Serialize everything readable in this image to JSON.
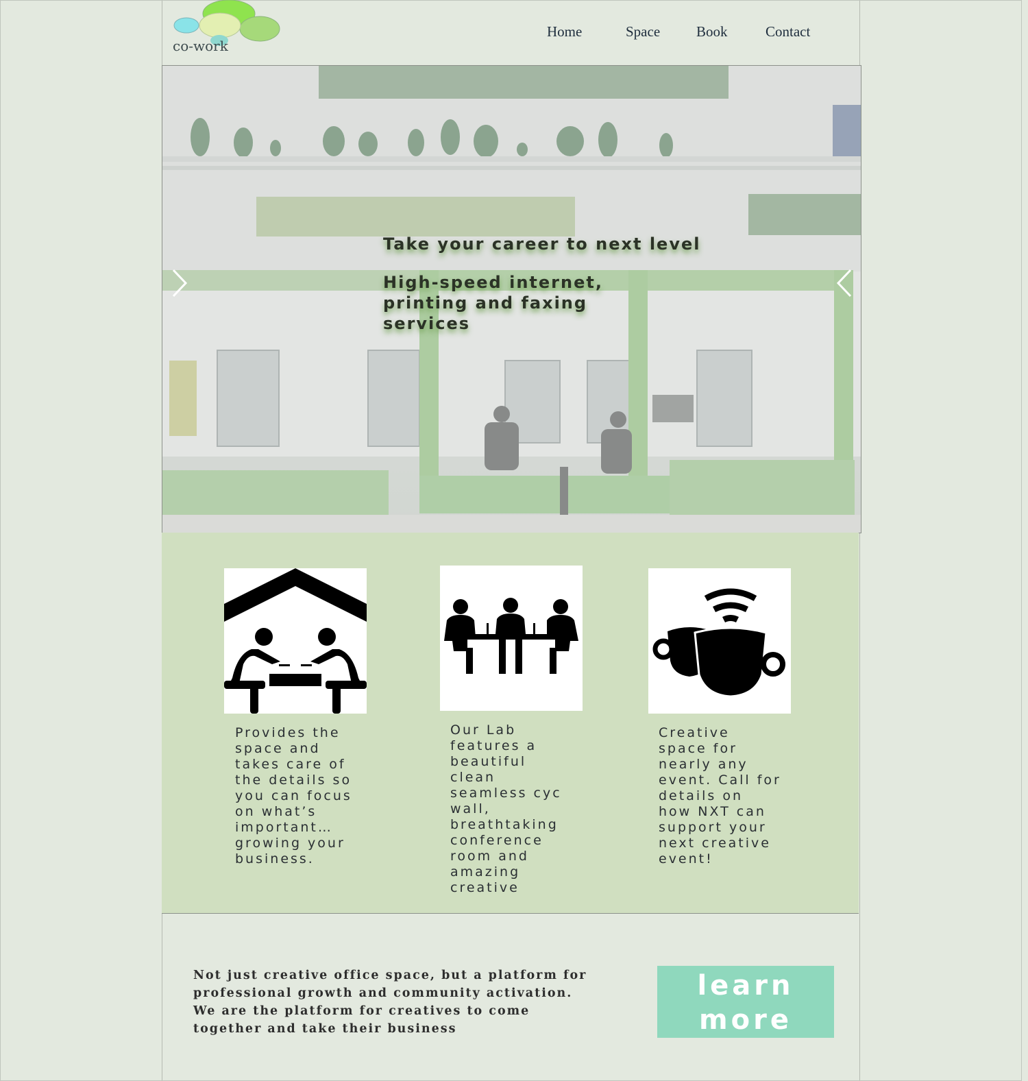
{
  "brand": {
    "name": "co-work"
  },
  "nav": {
    "items": [
      {
        "label": "Home"
      },
      {
        "label": "Space"
      },
      {
        "label": "Book"
      },
      {
        "label": "Contact"
      }
    ]
  },
  "hero": {
    "headline": "Take your career to next level",
    "subtext": "High-speed internet, printing and faxing services",
    "prev_icon": "chevron-right-icon",
    "next_icon": "chevron-left-icon"
  },
  "features": [
    {
      "icon": "coworking-people-icon",
      "text": "Provides the space and takes care of the details so you can focus on what’s important… growing your business."
    },
    {
      "icon": "meeting-room-icon",
      "text": "Our Lab features a beautiful clean seamless cyc wall, breathtaking conference room and amazing creative"
    },
    {
      "icon": "coffee-wifi-icon",
      "text": "Creative space for nearly any event. Call for details on how NXT can support your next creative event!"
    }
  ],
  "bottom": {
    "text": "Not just creative office space, but a platform for professional growth and community activation. We are the platform for creatives to come together and take their business",
    "button_label": "learn more"
  },
  "colors": {
    "page_bg": "#e3e9df",
    "features_bg": "#d0dfc0",
    "button_bg": "#8fd8bd",
    "text_dark": "#2a2f33"
  }
}
